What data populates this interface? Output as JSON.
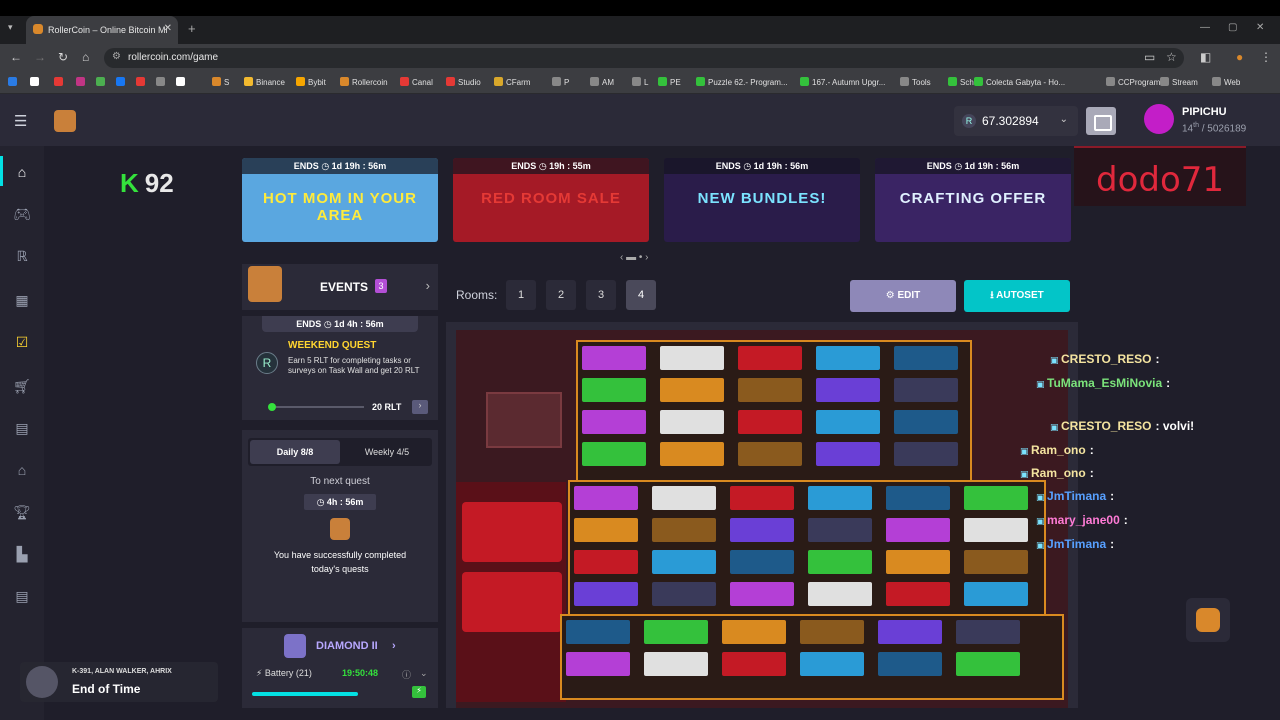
{
  "browser": {
    "tab_title": "RollerCoin – Online Bitcoin Mi",
    "url": "rollercoin.com/game",
    "bookmarks": [
      "S",
      "Binance",
      "Bybit",
      "Rollercoin",
      "Canal",
      "Studio",
      "CFarm",
      "P",
      "AM",
      "L",
      "PE",
      "Puzzle 62.- Program...",
      "167.- Autumn Upgr...",
      "Tools",
      "Sch",
      "Colecta Gabyta - Ho...",
      "CCProgram",
      "Stream",
      "Web"
    ]
  },
  "header": {
    "balance": "67.302894",
    "currency_icon": "R",
    "username": "PIPICHU",
    "rank": "14",
    "rank_suffix": "th",
    "rank_total": "/ 5026189"
  },
  "stream": {
    "viewer_count": "92",
    "kick_logo": "K",
    "streamer": "dodo71"
  },
  "banners": [
    {
      "ends": "ENDS",
      "time": "1d 19h : 56m",
      "title": "HOT MOM IN YOUR AREA",
      "color": "#5aa7e0"
    },
    {
      "ends": "ENDS",
      "time": "19h : 55m",
      "title": "RED ROOM SALE",
      "color": "#a51a26"
    },
    {
      "ends": "ENDS",
      "time": "1d 19h : 56m",
      "title": "NEW BUNDLES!",
      "color": "#2a1c4a"
    },
    {
      "ends": "ENDS",
      "time": "1d 19h : 56m",
      "title": "CRAFTING OFFER",
      "color": "#3a2464"
    }
  ],
  "events": {
    "label": "EVENTS",
    "count": "3"
  },
  "quest": {
    "ends": "ENDS",
    "time": "1d 4h : 56m",
    "title": "WEEKEND QUEST",
    "description": "Earn 5 RLT for completing tasks or surveys on Task Wall and get 20 RLT",
    "reward": "20 RLT",
    "progress": 0.0
  },
  "daily": {
    "tab_daily": "Daily",
    "daily_count": "8/8",
    "tab_weekly": "Weekly",
    "weekly_count": "4/5",
    "next_label": "To next quest",
    "time": "4h : 56m",
    "done_text": "You have successfully completed today's quests"
  },
  "league": {
    "title": "DIAMOND II",
    "battery": "Battery (21)",
    "time": "19:50:48"
  },
  "rooms": {
    "label": "Rooms:",
    "items": [
      "1",
      "2",
      "3",
      "4"
    ],
    "selected": "4"
  },
  "actions": {
    "edit": "EDIT",
    "autoset": "AUTOSET"
  },
  "chat": [
    {
      "user": "CRESTO_RESO",
      "msg": ":",
      "color": "#f4e4a0"
    },
    {
      "user": "TuMama_EsMiNovia",
      "msg": ":",
      "color": "#7be37b"
    },
    {
      "user": "CRESTO_RESO",
      "msg": ": volvi!",
      "color": "#f4e4a0"
    },
    {
      "user": "Ram_ono",
      "msg": ":",
      "color": "#f4e4a0"
    },
    {
      "user": "Ram_ono",
      "msg": ":",
      "color": "#f4e4a0"
    },
    {
      "user": "JmTimana",
      "msg": ":",
      "color": "#57a0ff"
    },
    {
      "user": "mary_jane00",
      "msg": ":",
      "color": "#ff7bd6"
    },
    {
      "user": "JmTimana",
      "msg": ":",
      "color": "#57a0ff"
    }
  ],
  "music": {
    "artists": "K-391, ALAN WALKER, AHRIX",
    "title": "End of Time"
  }
}
